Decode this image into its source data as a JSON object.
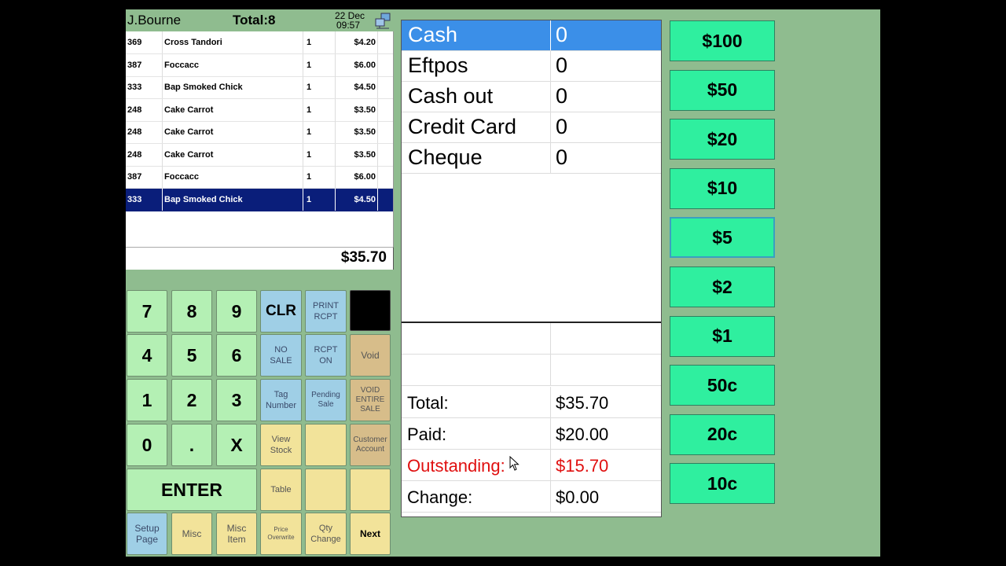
{
  "header": {
    "cashier": "J.Bourne",
    "total_label": "Total:8",
    "date": "22 Dec",
    "time": "09:57",
    "network_icon": "network-status-icon"
  },
  "items": [
    {
      "code": "369",
      "name": "Cross Tandori",
      "qty": "1",
      "price": "$4.20"
    },
    {
      "code": "387",
      "name": "Foccacc",
      "qty": "1",
      "price": "$6.00"
    },
    {
      "code": "333",
      "name": "Bap Smoked Chick",
      "qty": "1",
      "price": "$4.50"
    },
    {
      "code": "248",
      "name": "Cake Carrot",
      "qty": "1",
      "price": "$3.50"
    },
    {
      "code": "248",
      "name": "Cake Carrot",
      "qty": "1",
      "price": "$3.50"
    },
    {
      "code": "248",
      "name": "Cake Carrot",
      "qty": "1",
      "price": "$3.50"
    },
    {
      "code": "387",
      "name": "Foccacc",
      "qty": "1",
      "price": "$6.00"
    },
    {
      "code": "333",
      "name": "Bap Smoked Chick",
      "qty": "1",
      "price": "$4.50"
    }
  ],
  "selected_item_index": 7,
  "subtotal": "$35.70",
  "keypad": {
    "k7": "7",
    "k8": "8",
    "k9": "9",
    "k4": "4",
    "k5": "5",
    "k6": "6",
    "k1": "1",
    "k2": "2",
    "k3": "3",
    "k0": "0",
    "kdot": ".",
    "kx": "X",
    "enter": "ENTER",
    "clr": "CLR",
    "print_rcpt": "PRINT\nRCPT",
    "no_sale": "NO\nSALE",
    "rcpt_on": "RCPT\nON",
    "void": "Void",
    "tag_number": "Tag\nNumber",
    "pending_sale": "Pending\nSale",
    "void_entire_sale": "VOID\nENTIRE\nSALE",
    "view_stock": "View\nStock",
    "customer_account": "Customer\nAccount",
    "table": "Table",
    "setup_page": "Setup\nPage",
    "misc": "Misc",
    "misc_item": "Misc\nItem",
    "price_overwrite": "Price\nOverwrite",
    "qty_change": "Qty\nChange",
    "next": "Next"
  },
  "payment_methods": [
    {
      "label": "Cash",
      "value": "0"
    },
    {
      "label": "Eftpos",
      "value": "0"
    },
    {
      "label": "Cash out",
      "value": "0"
    },
    {
      "label": "Credit Card",
      "value": "0"
    },
    {
      "label": "Cheque",
      "value": "0"
    }
  ],
  "active_payment_index": 0,
  "summary": {
    "total_label": "Total:",
    "total_value": "$35.70",
    "paid_label": "Paid:",
    "paid_value": "$20.00",
    "outstanding_label": "Outstanding:",
    "outstanding_value": "$15.70",
    "change_label": "Change:",
    "change_value": "$0.00"
  },
  "denominations": [
    "$100",
    "$50",
    "$20",
    "$10",
    "$5",
    "$2",
    "$1",
    "50c",
    "20c",
    "10c"
  ],
  "highlighted_denomination_index": 4,
  "colors": {
    "background": "#8fbc8f",
    "selected_row": "#0a1e7a",
    "active_payment": "#3b8fe8",
    "denomination": "#2fef9f",
    "outstanding": "#e01010"
  }
}
